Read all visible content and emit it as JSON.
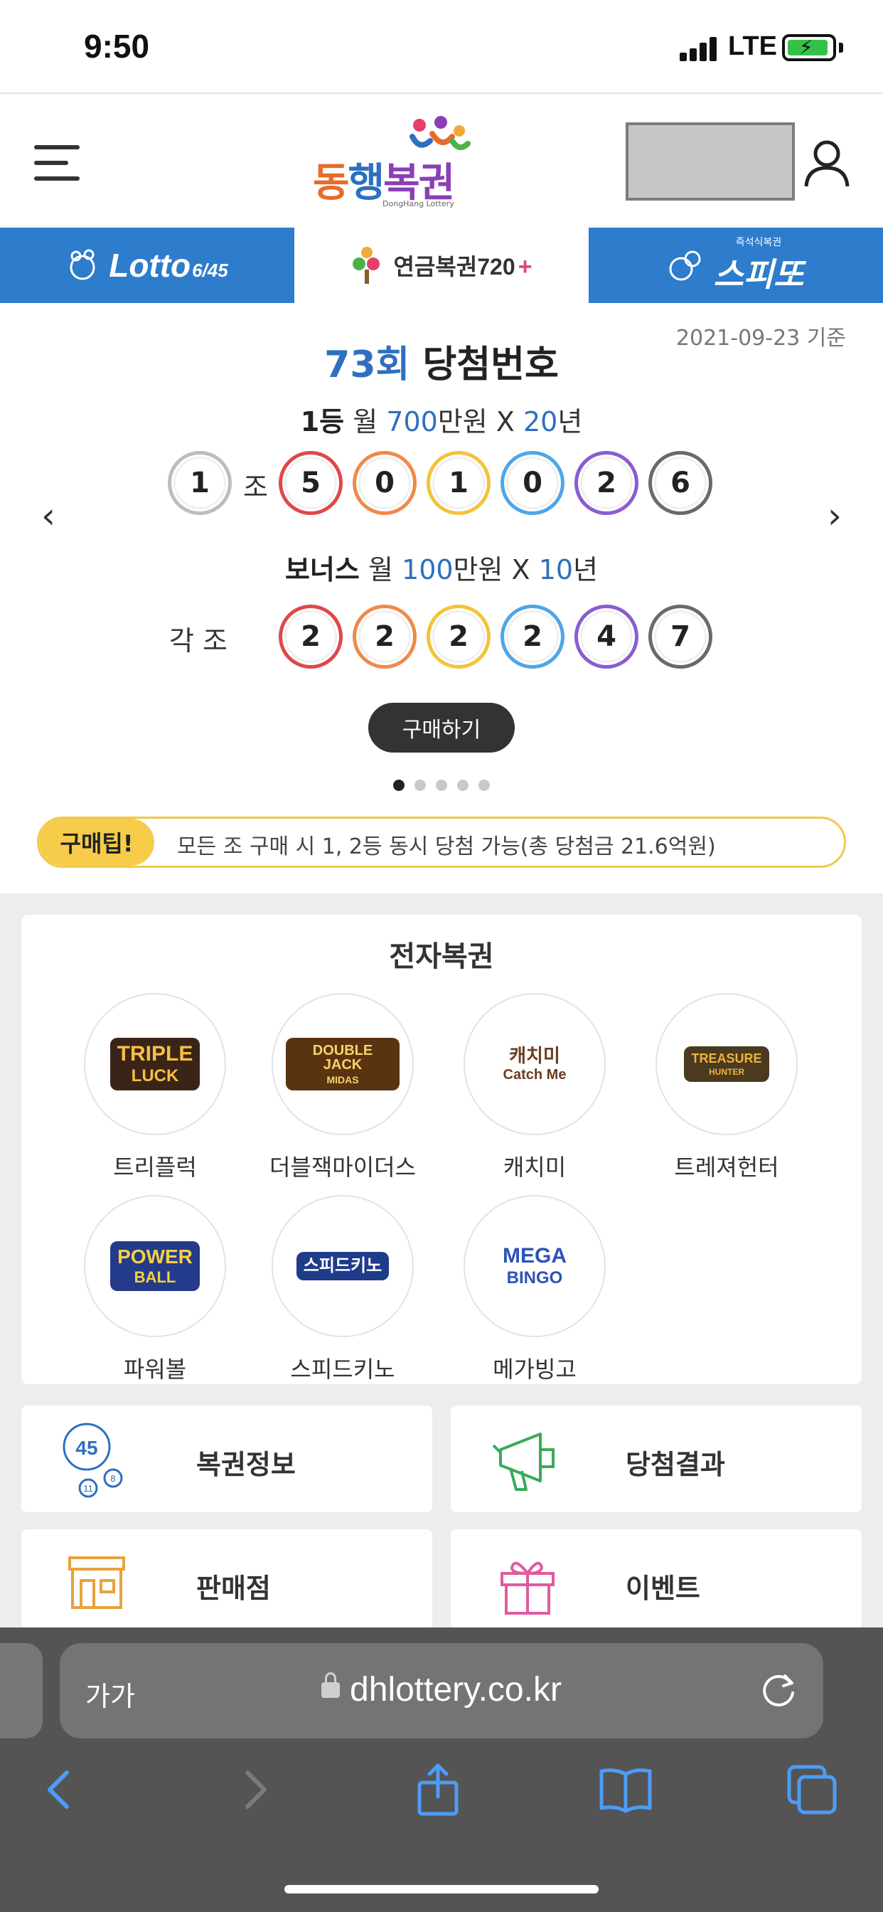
{
  "status_bar": {
    "time": "9:50",
    "network": "LTE"
  },
  "header": {
    "logo_text_1": "동",
    "logo_text_2": "행",
    "logo_text_3": "복권",
    "logo_sub": "DongHang Lottery"
  },
  "lotto_tabs": {
    "lotto_label": "Lotto",
    "lotto_sub": "6/45",
    "pension_label": "연금복권720",
    "pension_plus": "+",
    "speetto_pre": "즉석식복권",
    "speetto_label": "스피또"
  },
  "draw": {
    "date": "2021-09-23 기준",
    "round": "73회",
    "title": "당첨번호",
    "first_rank": "1등",
    "first_monthly_prefix": "월",
    "first_amount": "700",
    "first_unit": "만원 X",
    "first_years": "20",
    "first_years_unit": "년",
    "group_number": "1",
    "group_label": "조",
    "first_numbers": [
      "5",
      "0",
      "1",
      "0",
      "2",
      "6"
    ],
    "bonus_rank": "보너스",
    "bonus_monthly_prefix": "월",
    "bonus_amount": "100",
    "bonus_unit": "만원 X",
    "bonus_years": "10",
    "bonus_years_unit": "년",
    "bonus_group_label": "각 조",
    "bonus_numbers": [
      "2",
      "2",
      "2",
      "2",
      "4",
      "7"
    ],
    "ball_colors": [
      "#e04848",
      "#ef8a4a",
      "#f3c33b",
      "#4da6e8",
      "#8a5cd0",
      "#6a6a6a"
    ],
    "group_ball_color": "#bdbdbd",
    "buy_button": "구매하기",
    "prev_arrow": "‹",
    "next_arrow": "›",
    "carousel_pages": 5,
    "carousel_active": 1
  },
  "tip": {
    "badge": "구매팁!",
    "text": "모든 조 구매 시 1, 2등 동시 당첨 가능(총 당첨금 21.6억원)"
  },
  "e_lottery": {
    "title": "전자복권",
    "games": [
      {
        "name": "트리플럭",
        "logo_line1": "TRIPLE",
        "logo_line2": "LUCK"
      },
      {
        "name": "더블잭마이더스",
        "logo_line1": "DOUBLE JACK",
        "logo_line2": "MIDAS"
      },
      {
        "name": "캐치미",
        "logo_line1": "캐치미",
        "logo_line2": "Catch Me"
      },
      {
        "name": "트레져헌터",
        "logo_line1": "TREASURE",
        "logo_line2": "HUNTER"
      },
      {
        "name": "파워볼",
        "logo_line1": "POWER",
        "logo_line2": "BALL"
      },
      {
        "name": "스피드키노",
        "logo_line1": "스피드키노",
        "logo_line2": ""
      },
      {
        "name": "메가빙고",
        "logo_line1": "MEGA",
        "logo_line2": "BINGO"
      }
    ]
  },
  "menu": {
    "lottery_info": "복권정보",
    "lottery_info_icon_numbers": [
      "45",
      "11",
      "8"
    ],
    "results": "당첨결과",
    "stores": "판매점",
    "events": "이벤트"
  },
  "browser": {
    "aa": "가가",
    "url": "dhlottery.co.kr"
  }
}
